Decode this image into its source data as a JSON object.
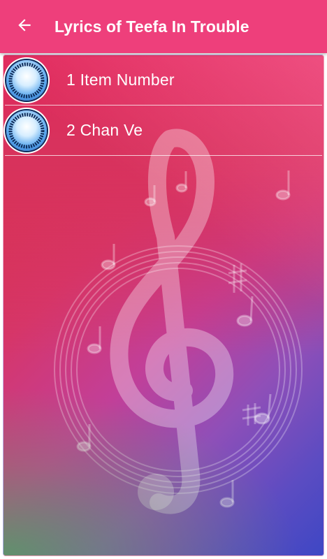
{
  "appbar": {
    "back_icon": "arrow-left-icon",
    "title": "Lyrics of Teefa In Trouble",
    "color": "#ee3f7b"
  },
  "list": {
    "items": [
      {
        "label": "1 Item Number",
        "avatar_text": "TEEFA IN TROUBLE SONGS & LYRICS"
      },
      {
        "label": "2 Chan Ve",
        "avatar_text": "TEEFA IN TROUBLE SONGS & LYRICS"
      }
    ]
  },
  "background": {
    "art": "treble-clef-music-notes",
    "colors": [
      "#d8313d",
      "#c23f98",
      "#3e47c4",
      "#46aa5a"
    ]
  }
}
